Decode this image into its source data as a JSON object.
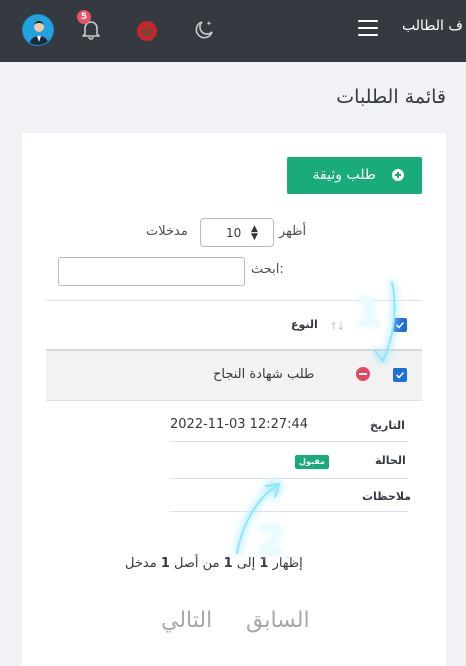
{
  "header": {
    "brand": "ف الطالب",
    "notifications_count": "5"
  },
  "page": {
    "title": "قائمة الطلبات"
  },
  "toolbar": {
    "add_label": "طلب وثيقة"
  },
  "length_control": {
    "show_label": "أظهر",
    "value": "10",
    "entries_label": "مدخلات"
  },
  "search": {
    "label": "ابحث:",
    "value": ""
  },
  "table": {
    "header_type": "النوع",
    "rows": [
      {
        "type": "طلب شهادة النجاح",
        "details": [
          {
            "label": "التاريخ",
            "value": "2022-11-03 12:27:44"
          },
          {
            "label": "الحالة",
            "value": "مقبول"
          },
          {
            "label": "ملاحظات",
            "value": ""
          }
        ]
      }
    ]
  },
  "info": {
    "prefix": "إظهار",
    "start": "1",
    "to": "إلى",
    "end": "1",
    "of": "من أصل",
    "total": "1",
    "suffix": "مدخل"
  },
  "pagination": {
    "previous": "السابق",
    "next": "التالي"
  },
  "annotations": {
    "first": "1",
    "second": "2"
  },
  "colors": {
    "topbar": "#343a40",
    "primary": "#1aab7b",
    "checkbox": "#1e6fd9",
    "danger": "#e0495e",
    "annotation": "#4fd0ff"
  }
}
